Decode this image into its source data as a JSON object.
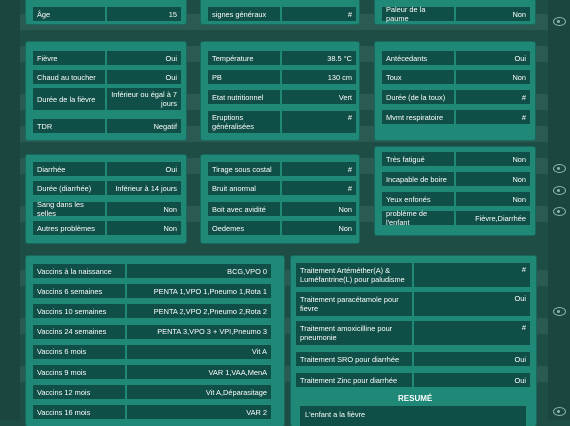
{
  "panel_top": {
    "col1": [
      {
        "label": "Âge",
        "value": "15"
      }
    ],
    "col2": [
      {
        "label": "signes généraux",
        "value": "#"
      }
    ],
    "col3": [
      {
        "label": "Paleur de la paume",
        "value": "Non"
      }
    ]
  },
  "panel_a": {
    "col1": [
      {
        "label": "Fièvre",
        "value": "Oui"
      },
      {
        "label": "Chaud au toucher",
        "value": "Oui"
      },
      {
        "label": "Durée de la fièvre",
        "value": "Inférieur ou égal à 7 jours"
      },
      {
        "label": "TDR",
        "value": "Negatif"
      }
    ],
    "col2": [
      {
        "label": "Température",
        "value": "38.5 °C"
      },
      {
        "label": "PB",
        "value": "130 cm"
      },
      {
        "label": "Etat nutritionnel",
        "value": "Vert"
      },
      {
        "label": "Eruptions généralisées",
        "value": "#"
      }
    ],
    "col3": [
      {
        "label": "Antécedants",
        "value": "Oui"
      },
      {
        "label": "Toux",
        "value": "Non"
      },
      {
        "label": "Durée (de la toux)",
        "value": "#"
      },
      {
        "label": "Mvmt respiratoire",
        "value": "#"
      }
    ]
  },
  "panel_b": {
    "col1": [
      {
        "label": "Diarrhée",
        "value": "Oui"
      },
      {
        "label": "Durée (diarrhée)",
        "value": "Inférieur à 14 jours"
      },
      {
        "label": "Sang dans les selles",
        "value": "Non"
      },
      {
        "label": "Autres problèmes",
        "value": "Non"
      }
    ],
    "col2": [
      {
        "label": "Tirage sous costal",
        "value": "#"
      },
      {
        "label": "Bruit anormal",
        "value": "#"
      },
      {
        "label": "Boit avec avidité",
        "value": "Non"
      },
      {
        "label": "Oedemes",
        "value": "Non"
      }
    ],
    "col3": [
      {
        "label": "Très fatigué",
        "value": "Non"
      },
      {
        "label": "Incapable de boire",
        "value": "Non"
      },
      {
        "label": "Yeux enfonés",
        "value": "Non"
      },
      {
        "label": "problème de l'enfant",
        "value": "Fièvre,Diarrhée"
      }
    ]
  },
  "vaccines": [
    {
      "label": "Vaccins à la naissance",
      "value": "BCG,VPO 0"
    },
    {
      "label": "Vaccins 6 semaines",
      "value": "PENTA 1,VPO 1,Pneumo 1,Rota 1"
    },
    {
      "label": "Vaccins 10 semaines",
      "value": "PENTA 2,VPO 2,Pneumo 2,Rota 2"
    },
    {
      "label": "Vaccins 24 semaines",
      "value": "PENTA 3,VPO 3 + VPI,Pneumo 3"
    },
    {
      "label": "Vaccins 6 mois",
      "value": "Vit A"
    },
    {
      "label": "Vaccins 9 mois",
      "value": "VAR 1,VAA,MenA"
    },
    {
      "label": "Vaccins 12 mois",
      "value": "Vit A,Déparasitage"
    },
    {
      "label": "Vaccins 16 mois",
      "value": "VAR 2"
    }
  ],
  "treatments": [
    {
      "label": "Traitement Artéméther(A) & Luméfantrine(L) pour paludisme",
      "value": "#"
    },
    {
      "label": "Traitement paracétamole pour fievre",
      "value": "Oui"
    },
    {
      "label": "Traitement amoxicilline pour pneumonie",
      "value": "#"
    },
    {
      "label": "Traitement SRO pour diarrhée",
      "value": "Oui"
    },
    {
      "label": "Traitement Zinc pour diarrhée",
      "value": "Oui"
    }
  ],
  "resume": {
    "title": "RESUMÉ",
    "text": "L'enfant a la fièvre"
  }
}
